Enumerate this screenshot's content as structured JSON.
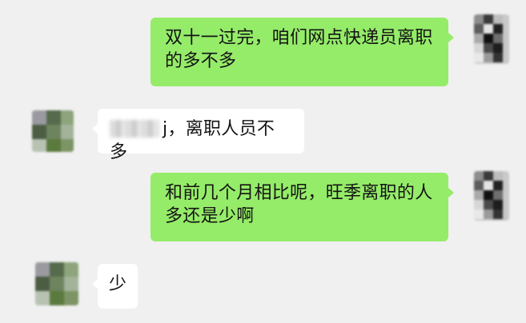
{
  "chat": {
    "messages": [
      {
        "direction": "sent",
        "lines": [
          "双十一过完，咱们网点快递员离职",
          "的多不多"
        ]
      },
      {
        "direction": "received",
        "text": "j，离职人员不多"
      },
      {
        "direction": "sent",
        "lines": [
          "和前几个月相比呢，旺季离职的人",
          "多还是少啊"
        ]
      },
      {
        "direction": "received",
        "text": "少"
      }
    ]
  },
  "colors": {
    "background": "#f0f0f0",
    "sent_bubble": "#95ec69",
    "received_bubble": "#ffffff",
    "text": "#141414"
  }
}
